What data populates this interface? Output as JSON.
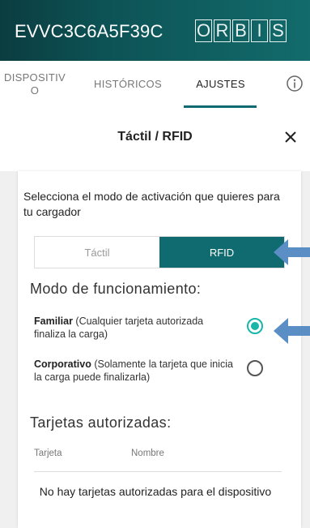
{
  "header": {
    "device_id": "EVVC3C6A5F39C",
    "logo_letters": [
      "O",
      "R",
      "B",
      "I",
      "S"
    ]
  },
  "tabs": [
    {
      "label": "DISPOSITIV\nO",
      "active": false
    },
    {
      "label": "HISTÓRICOS",
      "active": false
    },
    {
      "label": "AJUSTES",
      "active": true
    }
  ],
  "info_icon": "info-icon",
  "dialog": {
    "title": "Táctil / RFID",
    "close_icon": "close-icon"
  },
  "card": {
    "intro": "Selecciona el modo de activación que quieres para tu cargador",
    "segment": {
      "options": [
        "Táctil",
        "RFID"
      ],
      "selected": "RFID"
    },
    "mode_title": "Modo de funcionamiento:",
    "modes": [
      {
        "name": "Familiar",
        "desc": " (Cualquier tarjeta autorizada finaliza la carga)",
        "selected": true
      },
      {
        "name": "Corporativo",
        "desc": " (Solamente la tarjeta que inicia la carga puede finalizarla)",
        "selected": false
      }
    ],
    "cards_title": "Tarjetas autorizadas:",
    "columns": [
      "Tarjeta",
      "Nombre"
    ],
    "empty_text": "No hay tarjetas autorizadas para el dispositivo"
  },
  "colors": {
    "brand": "#0f6b6f",
    "radio_on": "#18b6a8",
    "annotation_arrow": "#5b8ec4"
  }
}
